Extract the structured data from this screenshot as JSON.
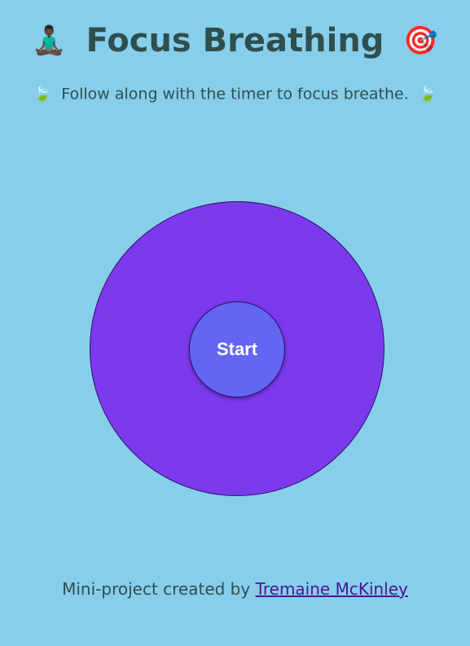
{
  "header": {
    "title": "Focus Breathing",
    "left_icon": "person-meditating-icon",
    "left_emoji": "🧘🏿‍♂️",
    "right_icon": "direct-hit-target-icon",
    "right_emoji": "🎯"
  },
  "subtitle": {
    "text": "Follow along with the timer to focus breathe.",
    "leaf_emoji": "🍃",
    "leaf_icon": "leaf-fluttering-icon"
  },
  "breather": {
    "button_label": "Start",
    "outer_color": "#7c3aed",
    "inner_color": "#6366f1"
  },
  "footer": {
    "prefix": "Mini-project created by",
    "author_link": "Tremaine McKinley"
  },
  "colors": {
    "background": "#87ceeb",
    "text": "#2f4f4f",
    "link": "#4b1590"
  }
}
